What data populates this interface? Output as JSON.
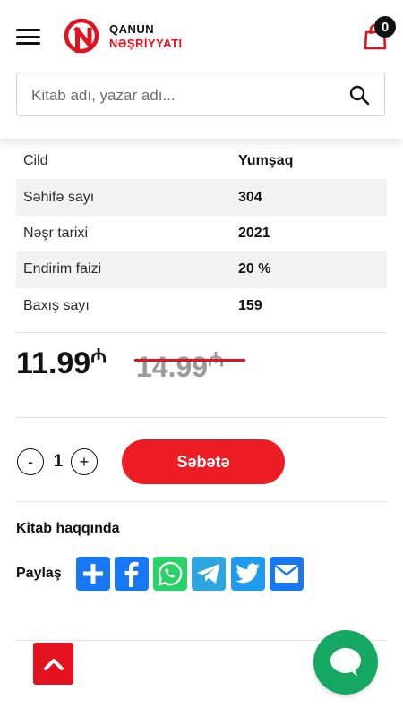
{
  "header": {
    "logo_line1": "QANUN",
    "logo_line2": "NƏŞRİYYATI",
    "cart_count": "0",
    "search_placeholder": "Kitab adı, yazar adı..."
  },
  "details": [
    {
      "label": "Cild",
      "value": "Yumşaq"
    },
    {
      "label": "Səhifə sayı",
      "value": "304"
    },
    {
      "label": "Nəşr tarixi",
      "value": "2021"
    },
    {
      "label": "Endirim faizi",
      "value": "20 %"
    },
    {
      "label": "Baxış sayı",
      "value": "159"
    }
  ],
  "price": {
    "current": "11.99",
    "old": "14.99",
    "currency": "₼"
  },
  "cart_form": {
    "minus": "-",
    "quantity": "1",
    "plus": "+",
    "add_label": "Səbətə"
  },
  "about_label": "Kitab haqqında",
  "share_label": "Paylaş",
  "share_icons": [
    {
      "name": "addthis-icon",
      "color": "#1877f2"
    },
    {
      "name": "facebook-icon",
      "color": "#1877f2"
    },
    {
      "name": "whatsapp-icon",
      "color": "#25d366"
    },
    {
      "name": "telegram-icon",
      "color": "#2ca5e0"
    },
    {
      "name": "twitter-icon",
      "color": "#1d9bf0"
    },
    {
      "name": "email-icon",
      "color": "#1877f2"
    }
  ],
  "colors": {
    "brand_red": "#e4121f",
    "chat_green": "#14a862"
  }
}
